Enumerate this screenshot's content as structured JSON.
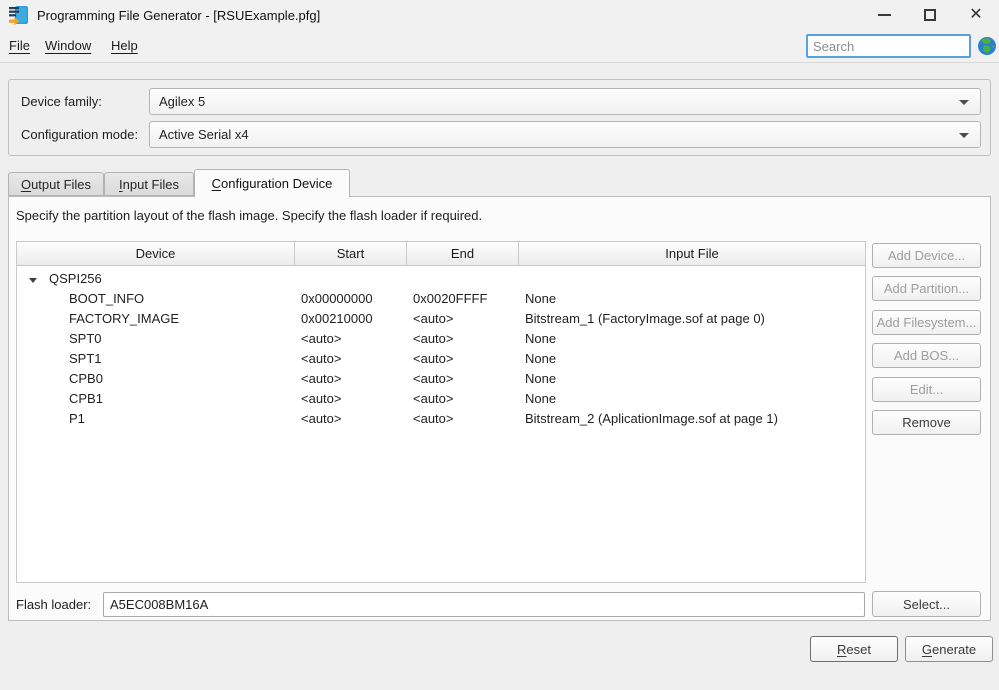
{
  "window": {
    "title": "Programming File Generator - [RSUExample.pfg]"
  },
  "icons": {
    "app": "programming-file-icon",
    "minimize": "–",
    "maximize": "□",
    "close": "✕",
    "globe": "help-globe-icon",
    "dropdown_arrow": "▼",
    "tree_expander": "▼"
  },
  "menu": {
    "items": [
      "File",
      "Window",
      "Help"
    ]
  },
  "search": {
    "placeholder": "Search"
  },
  "device_settings": {
    "family_label": "Device family:",
    "family_value": "Agilex 5",
    "mode_label": "Configuration mode:",
    "mode_value": "Active Serial x4"
  },
  "tabs": [
    {
      "mnemonic": "O",
      "rest": "utput Files",
      "active": false
    },
    {
      "mnemonic": "I",
      "rest": "nput Files",
      "active": false
    },
    {
      "mnemonic": "C",
      "rest": "onfiguration Device",
      "active": true
    }
  ],
  "panel": {
    "description": "Specify the partition layout of the flash image. Specify the flash loader if required."
  },
  "table": {
    "headers": [
      "Device",
      "Start",
      "End",
      "Input File"
    ],
    "rows": [
      {
        "name": "QSPI256",
        "start": "",
        "end": "",
        "input": "",
        "level": 0,
        "expanded": true
      },
      {
        "name": "BOOT_INFO",
        "start": "0x00000000",
        "end": "0x0020FFFF",
        "input": "None",
        "level": 1
      },
      {
        "name": "FACTORY_IMAGE",
        "start": "0x00210000",
        "end": "<auto>",
        "input": "Bitstream_1 (FactoryImage.sof at page 0)",
        "level": 1
      },
      {
        "name": "SPT0",
        "start": "<auto>",
        "end": "<auto>",
        "input": "None",
        "level": 1
      },
      {
        "name": "SPT1",
        "start": "<auto>",
        "end": "<auto>",
        "input": "None",
        "level": 1
      },
      {
        "name": "CPB0",
        "start": "<auto>",
        "end": "<auto>",
        "input": "None",
        "level": 1
      },
      {
        "name": "CPB1",
        "start": "<auto>",
        "end": "<auto>",
        "input": "None",
        "level": 1
      },
      {
        "name": "P1",
        "start": "<auto>",
        "end": "<auto>",
        "input": "Bitstream_2 (AplicationImage.sof at page 1)",
        "level": 1
      }
    ]
  },
  "actions": [
    {
      "label": "Add Device...",
      "enabled": false
    },
    {
      "label": "Add Partition...",
      "enabled": false
    },
    {
      "label": "Add Filesystem...",
      "enabled": false
    },
    {
      "label": "Add BOS...",
      "enabled": false
    },
    {
      "label": "Edit...",
      "enabled": false
    },
    {
      "label": "Remove",
      "enabled": true
    }
  ],
  "flash_loader": {
    "label": "Flash loader:",
    "value": "A5EC008BM16A",
    "select_label": "Select..."
  },
  "footer": {
    "reset_mnemonic": "R",
    "reset_rest": "eset",
    "generate_mnemonic": "G",
    "generate_rest": "enerate"
  },
  "colors": {
    "window_bg": "#efefef",
    "panel_bg": "#fbfbfb",
    "search_focus_border": "#5aa2dc",
    "disabled_text": "#9e9e9e",
    "icon_blue": "#2aa0dc",
    "icon_orange": "#f59e20",
    "globe_blue": "#2a7fd4",
    "globe_green": "#4caf3f"
  }
}
